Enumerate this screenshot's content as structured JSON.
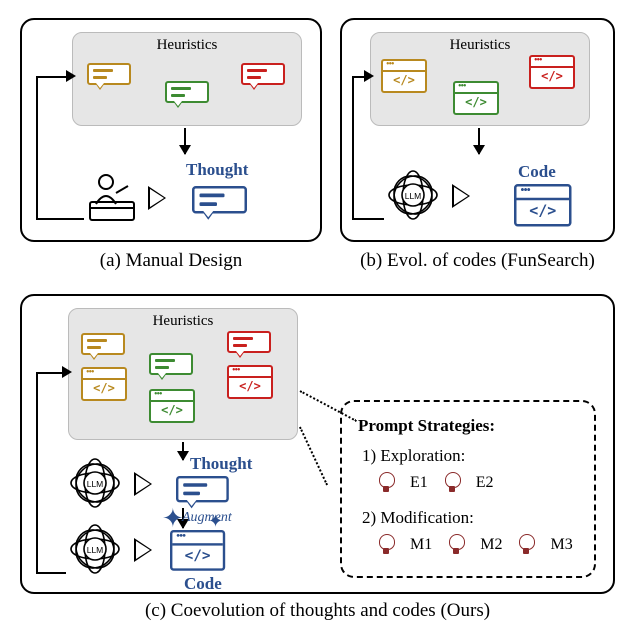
{
  "captions": {
    "a": "(a) Manual Design",
    "b": "(b) Evol. of codes (FunSearch)",
    "c": "(c) Coevolution of thoughts and codes (Ours)"
  },
  "heuristics_label": "Heuristics",
  "labels": {
    "thought": "Thought",
    "code": "Code",
    "augment": "Augment"
  },
  "llm_text": "LLM",
  "prompt_box": {
    "title": "Prompt Strategies:",
    "exploration_label": "1) Exploration:",
    "modification_label": "2) Modification:",
    "exploration_items": [
      "E1",
      "E2"
    ],
    "modification_items": [
      "M1",
      "M2",
      "M3"
    ]
  },
  "colors": {
    "gold": "#b8891f",
    "green": "#3d8b32",
    "red": "#c9201e",
    "blue": "#2b4f8e"
  },
  "chart_data": {
    "type": "diagram",
    "panels": [
      {
        "id": "a",
        "caption": "(a) Manual Design",
        "heuristics_repr": "thought-bubbles",
        "heuristics_colors": [
          "gold",
          "green",
          "red"
        ],
        "agent": "human",
        "output": {
          "kind": "thought",
          "label": "Thought",
          "repr": "chat-bubble",
          "color": "blue"
        },
        "feedback_loop": true
      },
      {
        "id": "b",
        "caption": "(b) Evol. of codes (FunSearch)",
        "heuristics_repr": "code-windows",
        "heuristics_colors": [
          "gold",
          "green",
          "red"
        ],
        "agent": "LLM",
        "output": {
          "kind": "code",
          "label": "Code",
          "repr": "code-window",
          "color": "blue"
        },
        "feedback_loop": true
      },
      {
        "id": "c",
        "caption": "(c) Coevolution of thoughts and codes (Ours)",
        "heuristics_repr": "thought-and-code-pairs",
        "heuristics_colors": [
          "gold",
          "green",
          "red"
        ],
        "agents": [
          "LLM",
          "LLM"
        ],
        "outputs": [
          {
            "kind": "thought",
            "label": "Thought",
            "repr": "chat-bubble",
            "color": "blue"
          },
          {
            "kind": "code",
            "label": "Code",
            "repr": "code-window",
            "color": "blue"
          }
        ],
        "augment_between_outputs": true,
        "feedback_loop": true,
        "prompt_strategies": {
          "Exploration": [
            "E1",
            "E2"
          ],
          "Modification": [
            "M1",
            "M2",
            "M3"
          ]
        }
      }
    ]
  }
}
